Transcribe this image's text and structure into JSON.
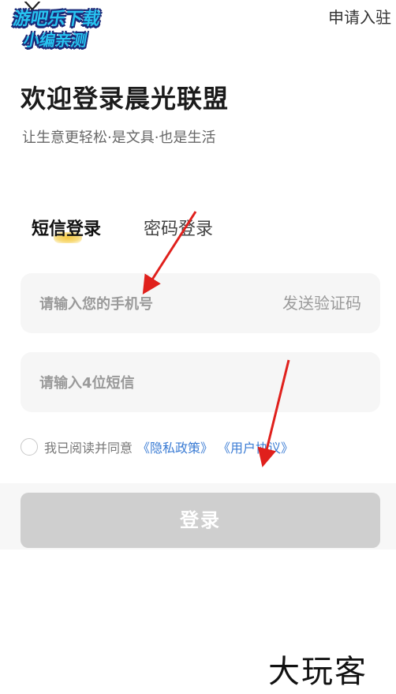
{
  "header": {
    "apply_label": "申请入驻"
  },
  "watermark": {
    "line1": "游吧乐下载",
    "line2": "小编亲测"
  },
  "login": {
    "title": "欢迎登录晨光联盟",
    "subtitle": "让生意更轻松·是文具·也是生活",
    "tabs": [
      {
        "label": "短信登录",
        "active": true
      },
      {
        "label": "密码登录",
        "active": false
      }
    ],
    "phone": {
      "placeholder": "请输入您的手机号",
      "value": ""
    },
    "send_code_label": "发送验证码",
    "code": {
      "placeholder": "请输入4位短信",
      "value": ""
    },
    "agreement": {
      "checked": false,
      "prefix": "我已阅读并同意",
      "privacy_label": "《隐私政策》",
      "user_label": "《用户协议》"
    },
    "submit_label": "登录"
  },
  "brand": {
    "label": "大玩客"
  },
  "colors": {
    "accent_tab": "#f6c943",
    "link": "#3b7cd4",
    "button_disabled": "#cfcfcf",
    "annotation_arrow": "#e0201c"
  },
  "icons": {
    "close": "close-icon",
    "checkbox": "radio-unchecked-icon"
  }
}
